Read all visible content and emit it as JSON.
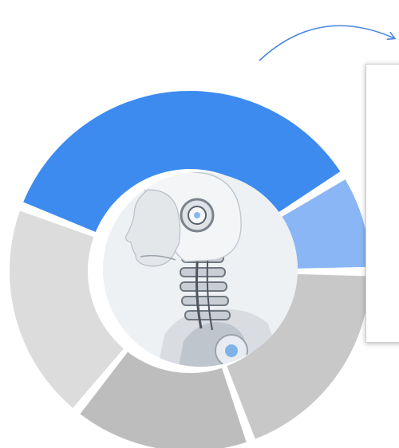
{
  "header": {
    "text": ""
  },
  "colors": {
    "primary_blue": "#3d8bef",
    "light_blue": "#8ab6f5",
    "gray_light": "#dcdcdc",
    "gray_mid": "#c8c8c8",
    "gray_dark": "#bdbdbd",
    "arrow_blue": "#4a86e0",
    "center_bg": "#eef1f4"
  },
  "center_image": {
    "icon": "robot-head-profile-icon"
  },
  "chart_data": {
    "type": "pie",
    "style": "donut",
    "categories": [
      "",
      "",
      "",
      "",
      ""
    ],
    "values": [
      0.335,
      0.085,
      0.185,
      0.155,
      0.19
    ],
    "colors": [
      "#3d8bef",
      "#8ab6f5",
      "#c8c8c8",
      "#bdbdbd",
      "#dcdcdc"
    ],
    "legend": "none",
    "grid": false
  },
  "info_box": {
    "text": ""
  }
}
